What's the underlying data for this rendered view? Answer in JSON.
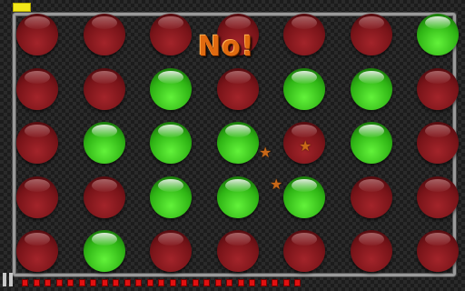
{
  "game": {
    "message": "No!",
    "grid": [
      [
        "red",
        "red",
        "red",
        "red",
        "red",
        "red",
        "green"
      ],
      [
        "red",
        "red",
        "green",
        "red",
        "green",
        "green",
        "red"
      ],
      [
        "red",
        "green",
        "green",
        "green",
        "red",
        "green",
        "red"
      ],
      [
        "red",
        "red",
        "green",
        "green",
        "green",
        "red",
        "red"
      ],
      [
        "red",
        "green",
        "red",
        "red",
        "red",
        "red",
        "red"
      ]
    ],
    "colors": {
      "red": "#8a1a1f",
      "green": "#3cc81e",
      "timer": "#e01010",
      "indicator": "#f2e81a",
      "message": "#e06a10"
    },
    "timer_segments": 25,
    "stars": 3,
    "icons": {
      "pause": "pause-icon",
      "star": "star-icon"
    }
  }
}
